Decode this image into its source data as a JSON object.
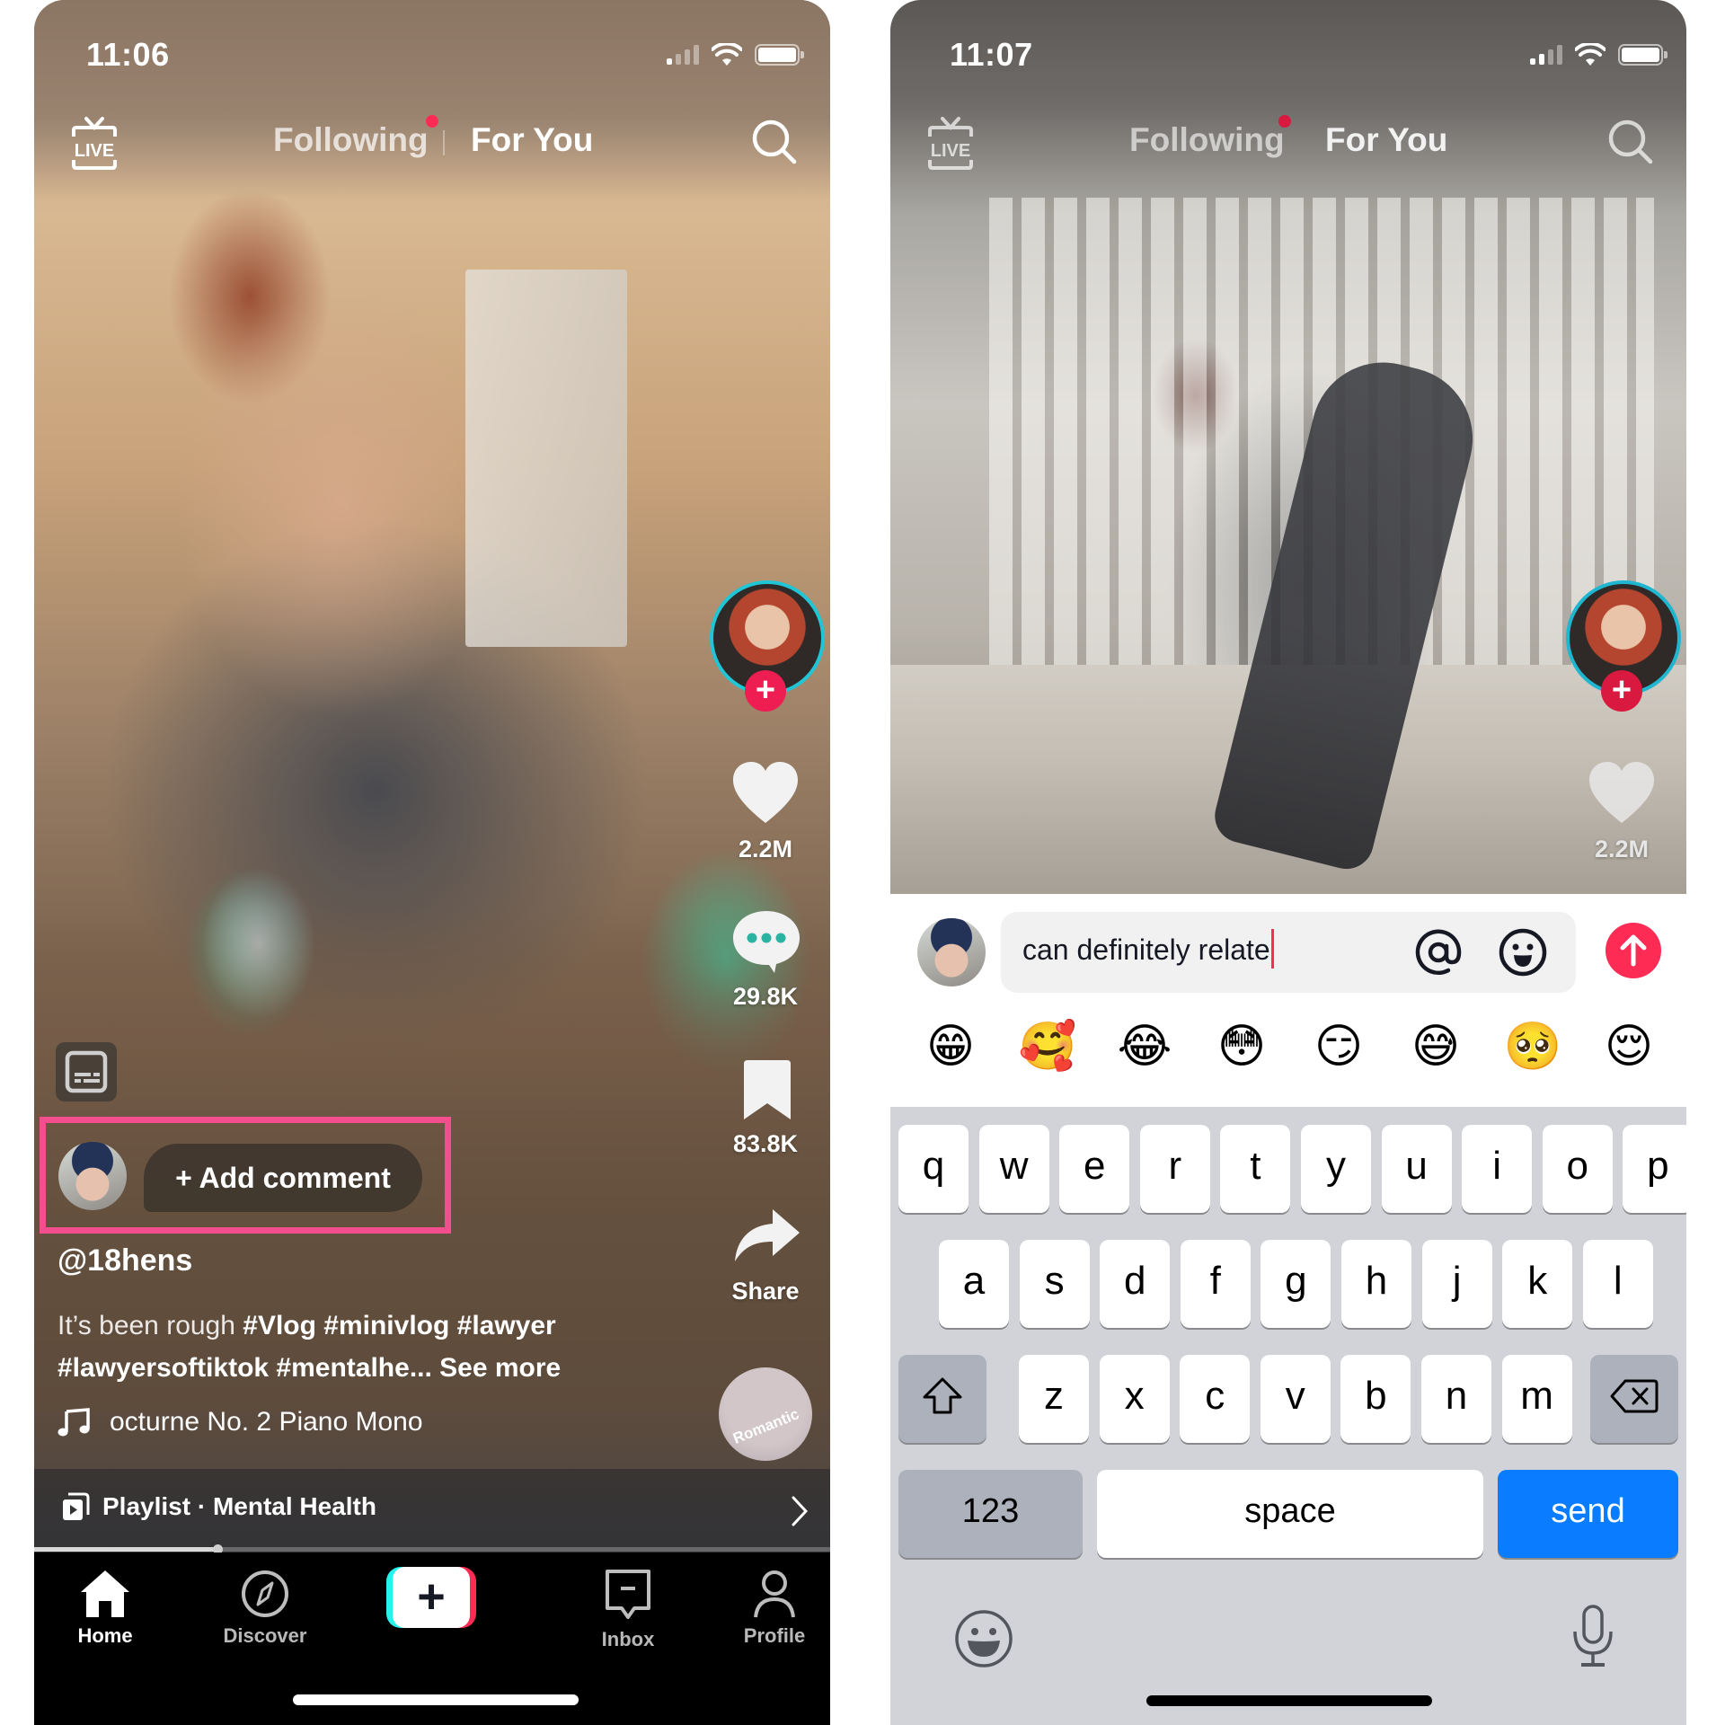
{
  "left_phone": {
    "status": {
      "time": "11:06",
      "signal_bars": 1,
      "signal_total": 4
    },
    "header": {
      "live_label": "LIVE",
      "tabs": [
        {
          "label": "Following",
          "active": false,
          "has_notification_dot": true
        },
        {
          "label": "For You",
          "active": true
        }
      ]
    },
    "rail": {
      "likes": "2.2M",
      "comments": "29.8K",
      "saves": "83.8K",
      "share_label": "Share",
      "follow_plus": "+",
      "music_disc_label": "Romantic"
    },
    "add_comment": {
      "label": "+ Add comment"
    },
    "post": {
      "username": "@18hens",
      "caption_plain": "It’s been rough ",
      "caption_tags_line1": "#Vlog #minivlog #lawyer",
      "caption_tags_line2": "#lawyersoftiktok #mentalhe...",
      "see_more": "See more",
      "music": "octurne No. 2 Piano Mono"
    },
    "playlist": {
      "label": "Playlist · Mental Health"
    },
    "playback_progress": 0.23,
    "nav": {
      "items": [
        {
          "label": "Home",
          "active": true
        },
        {
          "label": "Discover",
          "active": false
        },
        {
          "label": "",
          "active": false
        },
        {
          "label": "Inbox",
          "active": false
        },
        {
          "label": "Profile",
          "active": false
        }
      ],
      "create_symbol": "+"
    }
  },
  "right_phone": {
    "status": {
      "time": "11:07",
      "signal_bars": 2,
      "signal_total": 4
    },
    "header": {
      "live_label": "LIVE",
      "tabs": [
        {
          "label": "Following",
          "active": false,
          "has_notification_dot": true
        },
        {
          "label": "For You",
          "active": true
        }
      ]
    },
    "rail": {
      "likes": "2.2M",
      "follow_plus": "+"
    },
    "comment_box": {
      "value": "can definitely relate",
      "mention_icon": "at-icon",
      "emoji_icon": "emoji-icon",
      "post_icon": "arrow-up-icon"
    },
    "quick_emojis": [
      "😁",
      "🥰",
      "😂",
      "😳",
      "😏",
      "😅",
      "🥺",
      "😌"
    ],
    "keyboard": {
      "row1": [
        "q",
        "w",
        "e",
        "r",
        "t",
        "y",
        "u",
        "i",
        "o",
        "p"
      ],
      "row2": [
        "a",
        "s",
        "d",
        "f",
        "g",
        "h",
        "j",
        "k",
        "l"
      ],
      "row3": [
        "z",
        "x",
        "c",
        "v",
        "b",
        "n",
        "m"
      ],
      "numbers_label": "123",
      "space_label": "space",
      "send_label": "send"
    }
  },
  "colors": {
    "tiktok_red": "#fe2c55",
    "tiktok_cyan": "#25f4ee",
    "highlight_pink": "#f34f8e",
    "ios_send_blue": "#0a7cff",
    "keyboard_bg": "#d1d3d9"
  }
}
